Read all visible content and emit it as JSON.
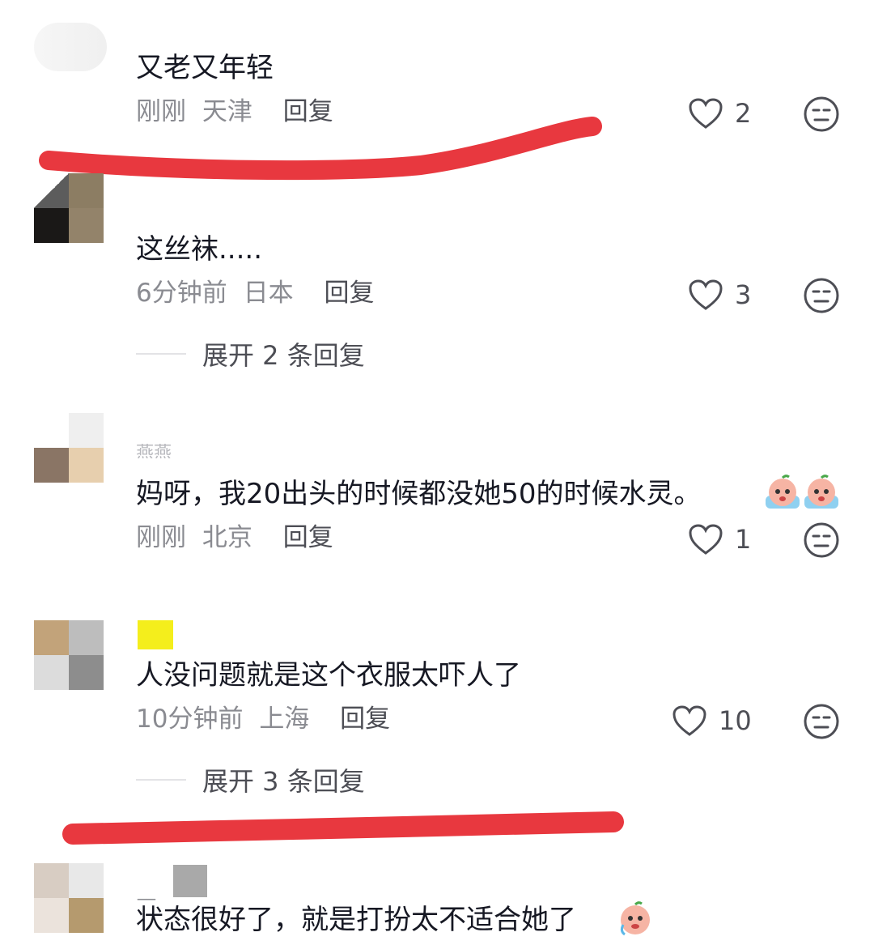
{
  "comments": [
    {
      "text": "又老又年轻",
      "time": "刚刚",
      "location": "天津",
      "reply_label": "回复",
      "likes": "2"
    },
    {
      "text": "这丝袜.....",
      "time": "6分钟前",
      "location": "日本",
      "reply_label": "回复",
      "likes": "3",
      "expand": "展开 2 条回复"
    },
    {
      "username": "燕燕",
      "text": "妈呀，我20出头的时候都没她50的时候水灵。",
      "time": "刚刚",
      "location": "北京",
      "reply_label": "回复",
      "likes": "1"
    },
    {
      "text": "人没问题就是这个衣服太吓人了",
      "time": "10分钟前",
      "location": "上海",
      "reply_label": "回复",
      "likes": "10",
      "expand": "展开 3 条回复"
    },
    {
      "username": "__",
      "text": "状态很好了，就是打扮太不适合她了"
    }
  ],
  "icons": {
    "like": "heart-outline-icon",
    "dislike": "meh-face-icon",
    "emoji": "crying-peach-emoji"
  },
  "colors": {
    "highlight_stroke": "#e8383f",
    "meta_text": "#8a8b91"
  }
}
